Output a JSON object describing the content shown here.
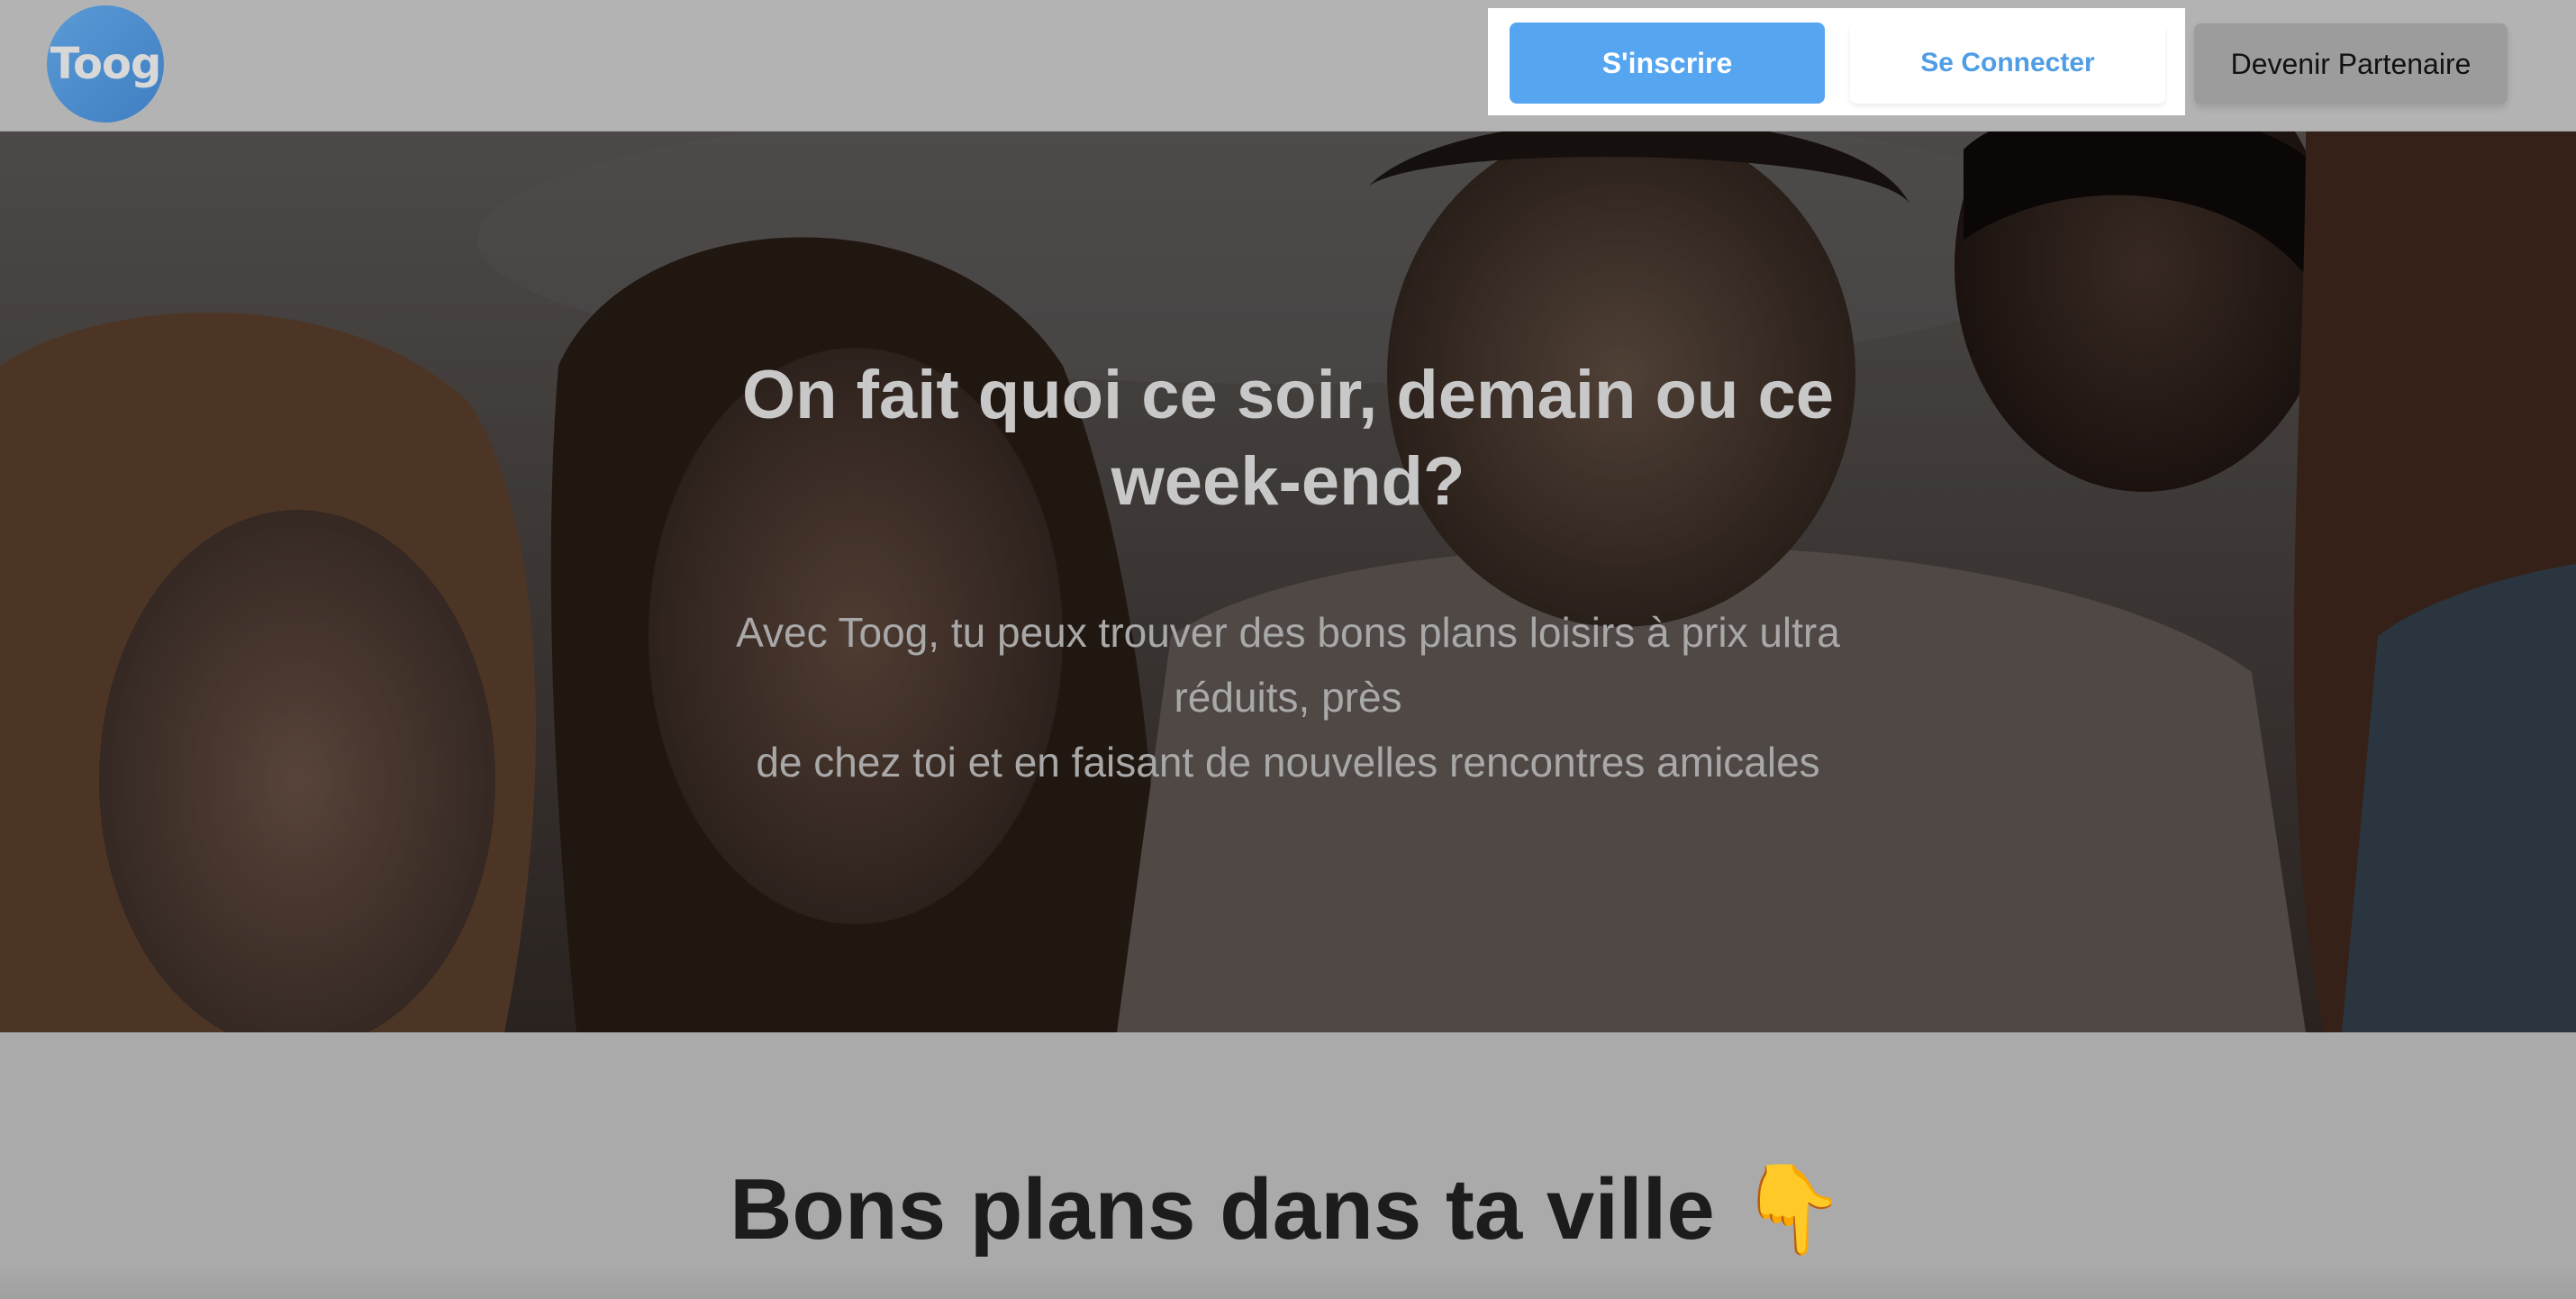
{
  "header": {
    "logo_text": "Toog",
    "signup_label": "S'inscrire",
    "login_label": "Se Connecter",
    "partner_label": "Devenir Partenaire"
  },
  "hero": {
    "title": "On fait quoi ce soir, demain ou ce week-end?",
    "subtitle_lines": [
      "Avec Toog, tu peux trouver des bons plans loisirs à prix ultra",
      "réduits, près",
      "de chez toi et en faisant de nouvelles rencontres amicales"
    ]
  },
  "section": {
    "title": "Bons plans dans ta ville",
    "emoji": "👇"
  },
  "colors": {
    "signup_bg": "#55a5f0",
    "login_text": "#4f9de6",
    "partner_bg": "#9c9c9c",
    "overlay": "#b3b3b3"
  },
  "icons": {
    "logo": "toog-logo",
    "pointing_down": "backhand-index-pointing-down-icon"
  }
}
